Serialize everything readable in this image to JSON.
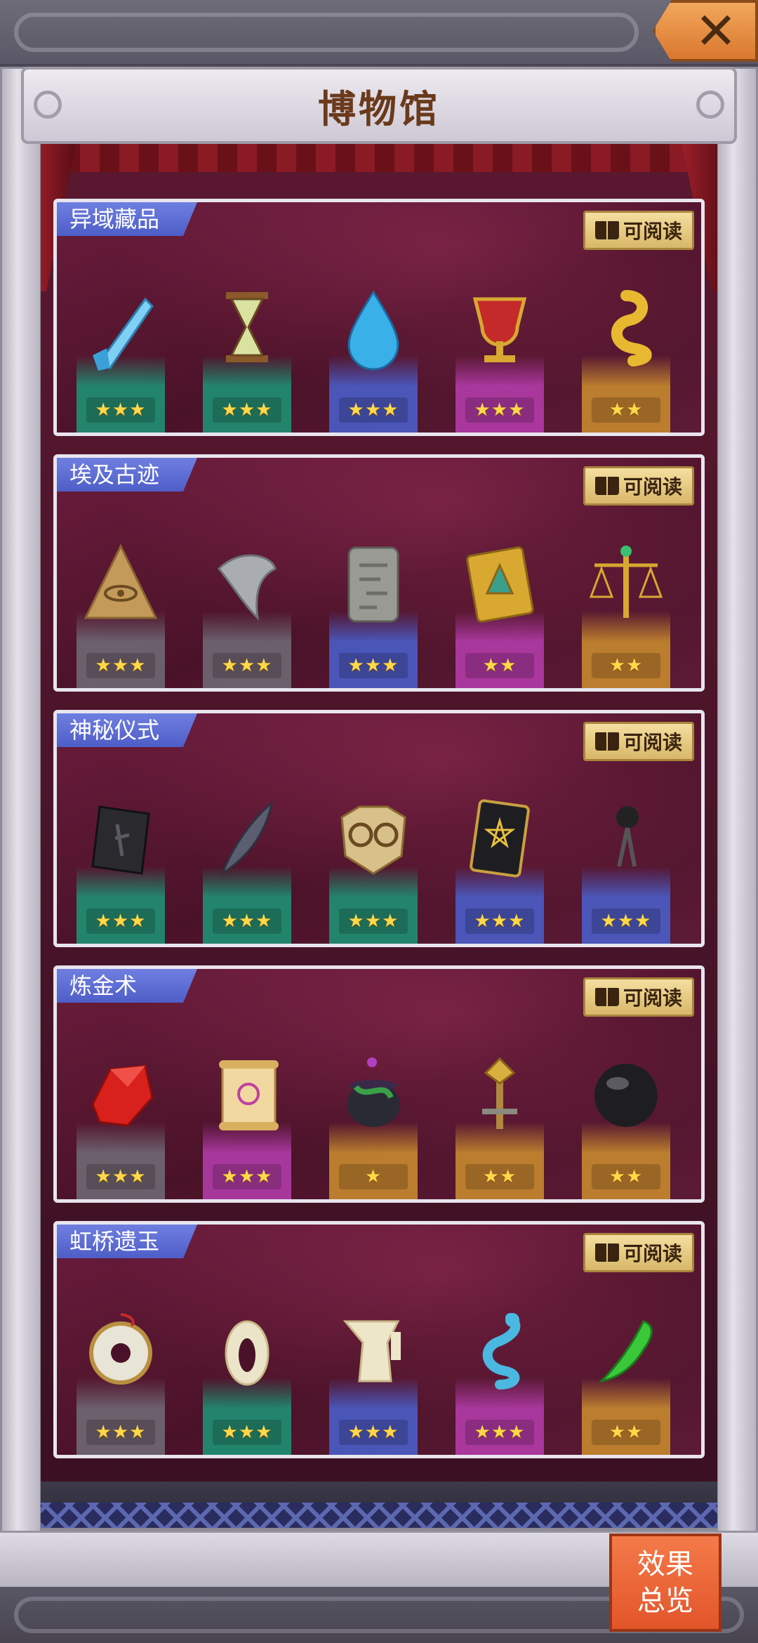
{
  "header": {
    "title": "博物馆",
    "close_icon": "close-icon"
  },
  "sections": [
    {
      "title": "异域藏品",
      "read_label": "可阅读",
      "items": [
        {
          "icon": "crystal-shard-icon",
          "stars": "★★★",
          "rarity": "green"
        },
        {
          "icon": "hourglass-icon",
          "stars": "★★★",
          "rarity": "green"
        },
        {
          "icon": "water-drop-icon",
          "stars": "★★★",
          "rarity": "blue"
        },
        {
          "icon": "goblet-icon",
          "stars": "★★★",
          "rarity": "pink"
        },
        {
          "icon": "golden-snake-icon",
          "stars": "★★",
          "rarity": "gold"
        }
      ]
    },
    {
      "title": "埃及古迹",
      "read_label": "可阅读",
      "items": [
        {
          "icon": "eye-pyramid-icon",
          "stars": "★★★",
          "rarity": "gray"
        },
        {
          "icon": "stone-fish-icon",
          "stars": "★★★",
          "rarity": "gray"
        },
        {
          "icon": "stone-tablet-icon",
          "stars": "★★★",
          "rarity": "blue"
        },
        {
          "icon": "golden-book-icon",
          "stars": "★★",
          "rarity": "pink"
        },
        {
          "icon": "scales-icon",
          "stars": "★★",
          "rarity": "gold"
        }
      ]
    },
    {
      "title": "神秘仪式",
      "read_label": "可阅读",
      "items": [
        {
          "icon": "rune-stone-icon",
          "stars": "★★★",
          "rarity": "green"
        },
        {
          "icon": "feather-quill-icon",
          "stars": "★★★",
          "rarity": "green"
        },
        {
          "icon": "owl-mask-icon",
          "stars": "★★★",
          "rarity": "green"
        },
        {
          "icon": "pentagram-book-icon",
          "stars": "★★★",
          "rarity": "blue"
        },
        {
          "icon": "black-pendant-icon",
          "stars": "★★★",
          "rarity": "blue"
        }
      ]
    },
    {
      "title": "炼金术",
      "read_label": "可阅读",
      "items": [
        {
          "icon": "red-gem-icon",
          "stars": "★★★",
          "rarity": "gray"
        },
        {
          "icon": "scroll-icon",
          "stars": "★★★",
          "rarity": "pink"
        },
        {
          "icon": "cauldron-icon",
          "stars": "★",
          "rarity": "gold"
        },
        {
          "icon": "golden-staff-icon",
          "stars": "★★",
          "rarity": "gold"
        },
        {
          "icon": "black-orb-icon",
          "stars": "★★",
          "rarity": "gold"
        }
      ]
    },
    {
      "title": "虹桥遗玉",
      "read_label": "可阅读",
      "items": [
        {
          "icon": "jade-disc-icon",
          "stars": "★★★",
          "rarity": "gray"
        },
        {
          "icon": "jade-ring-icon",
          "stars": "★★★",
          "rarity": "green"
        },
        {
          "icon": "jade-vessel-icon",
          "stars": "★★★",
          "rarity": "blue"
        },
        {
          "icon": "jade-dragon-icon",
          "stars": "★★★",
          "rarity": "pink"
        },
        {
          "icon": "green-jade-icon",
          "stars": "★★",
          "rarity": "gold"
        }
      ]
    }
  ],
  "footer": {
    "summary_line1": "效果",
    "summary_line2": "总览"
  }
}
